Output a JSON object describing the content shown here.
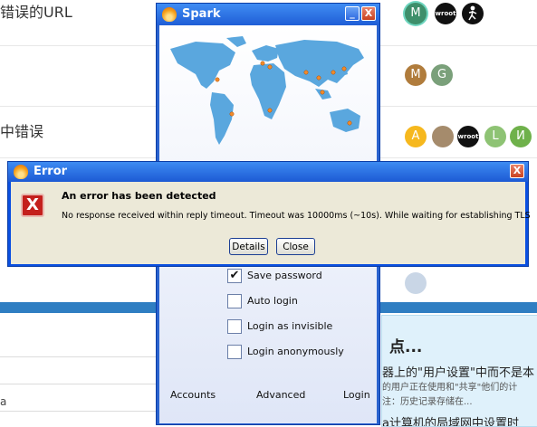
{
  "background": {
    "posts": [
      {
        "title": "错误的URL"
      },
      {
        "title": ""
      },
      {
        "title": "中错误"
      }
    ],
    "avatars": {
      "row1": [
        "M",
        "wroot",
        ""
      ],
      "row2": [
        "M",
        "G"
      ],
      "row3": [
        "A",
        "",
        "wroot",
        "L",
        "И"
      ]
    },
    "avatar_colors": {
      "teal": "#3e8f6b",
      "brown": "#b07c3c",
      "gray": "#7aa07a",
      "yellow": "#f6b81e",
      "lightgreen": "#8ec374",
      "green": "#6fb14b",
      "dark": "#111111"
    },
    "search_label": "a",
    "notice": {
      "title": "点...",
      "line1": "器上的\"用户设置\"中而不是本",
      "line2": "的用户正在使用和\"共享\"他们的计",
      "line3": "注：历史记录存储在...",
      "line4": "a计算机的局域网中设置时"
    }
  },
  "spark": {
    "title": "Spark",
    "min_label": "_",
    "close_label": "X",
    "options": [
      {
        "label": "Save password",
        "checked": true,
        "mark": "✔"
      },
      {
        "label": "Auto login",
        "checked": false,
        "mark": ""
      },
      {
        "label": "Login as invisible",
        "checked": false,
        "mark": ""
      },
      {
        "label": "Login anonymously",
        "checked": false,
        "mark": ""
      }
    ],
    "links": {
      "accounts": "Accounts",
      "advanced": "Advanced",
      "login": "Login"
    }
  },
  "error_dialog": {
    "title": "Error",
    "close_label": "X",
    "icon_glyph": "X",
    "heading": "An error has been detected",
    "message": "No response received within reply timeout. Timeout was 10000ms (~10s). While waiting for establishing TLS",
    "details_label": "Details",
    "close_button_label": "Close"
  },
  "colors": {
    "titlebar_blue": "#2a63cf",
    "dialog_bg": "#ece9d8",
    "error_red": "#c4201d",
    "map_blue": "#5aa7de"
  }
}
